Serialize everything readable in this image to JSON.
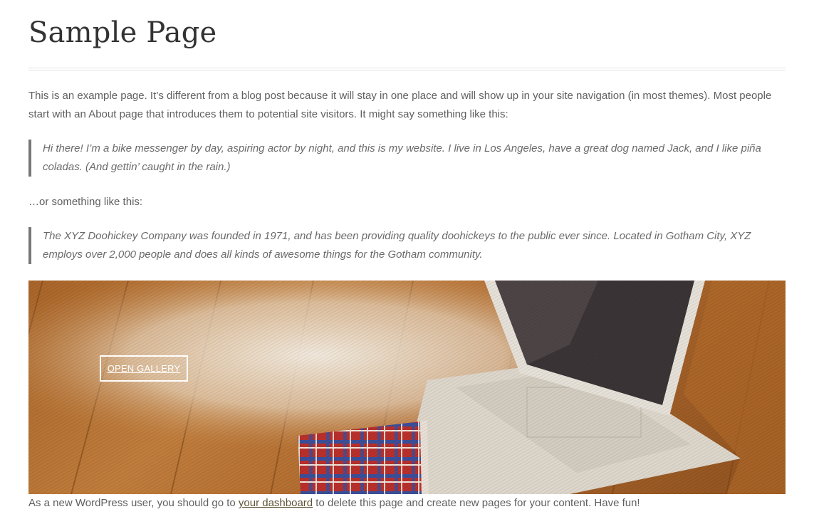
{
  "page": {
    "title": "Sample Page"
  },
  "content": {
    "intro": "This is an example page. It’s different from a blog post because it will stay in one place and will show up in your site navigation (in most themes). Most people start with an About page that introduces them to potential site visitors. It might say something like this:",
    "quote_1": "Hi there! I’m a bike messenger by day, aspiring actor by night, and this is my website. I live in Los Angeles, have a great dog named Jack, and I like piña coladas. (And gettin’ caught in the rain.)",
    "or_text": "…or something like this:",
    "quote_2": "The XYZ Doohickey Company was founded in 1971, and has been providing quality doohickeys to the public ever since. Located in Gotham City, XYZ employs over 2,000 people and does all kinds of awesome things for the Gotham community.",
    "outro_before": "As a new WordPress user, you should go to ",
    "outro_link": "your dashboard",
    "outro_after": " to delete this page and create new pages for your content. Have fun!"
  },
  "gallery": {
    "button_label": "OPEN GALLERY"
  },
  "colors": {
    "title": "#333333",
    "text": "#5f5f5f",
    "quote_border": "#777777",
    "link": "#5e5233",
    "wood": "#b06a2e"
  }
}
